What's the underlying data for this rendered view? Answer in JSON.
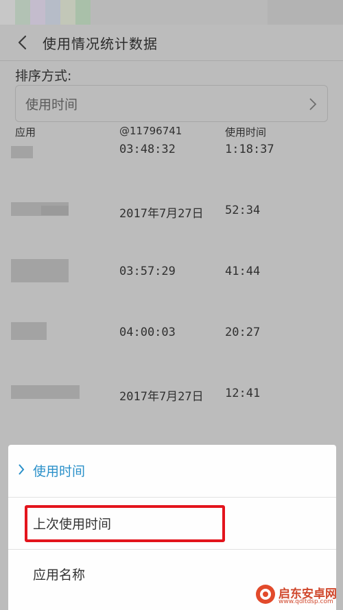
{
  "titlebar": {
    "title": "使用情况统计数据"
  },
  "sort": {
    "label": "排序方式:",
    "value": "使用时间"
  },
  "table": {
    "headers": [
      "应用",
      "@11796741",
      "使用时间"
    ],
    "rows": [
      {
        "last_used": "03:48:32",
        "usage": "1:18:37"
      },
      {
        "last_used": "2017年7月27日",
        "usage": "52:34"
      },
      {
        "last_used": "03:57:29",
        "usage": "41:44"
      },
      {
        "last_used": "04:00:03",
        "usage": "20:27"
      },
      {
        "last_used": "2017年7月27日",
        "usage": "12:41"
      }
    ]
  },
  "sheet": {
    "options": [
      {
        "label": "使用时间",
        "selected": true
      },
      {
        "label": "上次使用时间",
        "selected": false
      },
      {
        "label": "应用名称",
        "selected": false
      }
    ]
  },
  "watermark": {
    "name": "启东安卓网",
    "url": "www.qdltdsp.com"
  },
  "colors": {
    "accent": "#2a90c9",
    "highlight": "#e3141c",
    "overlay": "#bcbcbc"
  }
}
